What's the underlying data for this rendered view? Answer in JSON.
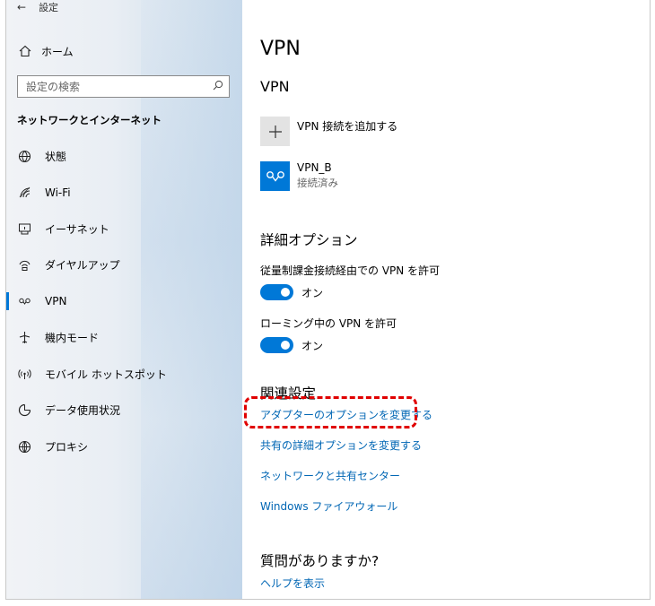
{
  "window": {
    "title": "設定",
    "back_label": "←"
  },
  "sidebar": {
    "home_label": "ホーム",
    "search": {
      "placeholder": "設定の検索"
    },
    "section_title": "ネットワークとインターネット",
    "items": [
      {
        "label": "状態",
        "icon": "globe-status-icon"
      },
      {
        "label": "Wi-Fi",
        "icon": "wifi-icon"
      },
      {
        "label": "イーサネット",
        "icon": "ethernet-icon"
      },
      {
        "label": "ダイヤルアップ",
        "icon": "dialup-icon"
      },
      {
        "label": "VPN",
        "icon": "vpn-icon",
        "active": true
      },
      {
        "label": "機内モード",
        "icon": "airplane-icon"
      },
      {
        "label": "モバイル ホットスポット",
        "icon": "hotspot-icon"
      },
      {
        "label": "データ使用状況",
        "icon": "data-usage-icon"
      },
      {
        "label": "プロキシ",
        "icon": "globe-icon"
      }
    ]
  },
  "main": {
    "page_title": "VPN",
    "section_vpn": "VPN",
    "add_vpn_label": "VPN 接続を追加する",
    "connection": {
      "name": "VPN_B",
      "status": "接続済み"
    },
    "advanced_title": "詳細オプション",
    "metered_label": "従量制課金接続経由での VPN を許可",
    "metered_toggle": "オン",
    "roaming_label": "ローミング中の VPN を許可",
    "roaming_toggle": "オン",
    "related_title": "関連設定",
    "links": {
      "adapter": "アダプターのオプションを変更する",
      "sharing_advanced": "共有の詳細オプションを変更する",
      "network_center": "ネットワークと共有センター",
      "firewall": "Windows ファイアウォール"
    },
    "question_title": "質問がありますか?",
    "help_link": "ヘルプを表示"
  },
  "colors": {
    "accent": "#0078d7",
    "link": "#0066b4",
    "highlight": "#e00000"
  }
}
